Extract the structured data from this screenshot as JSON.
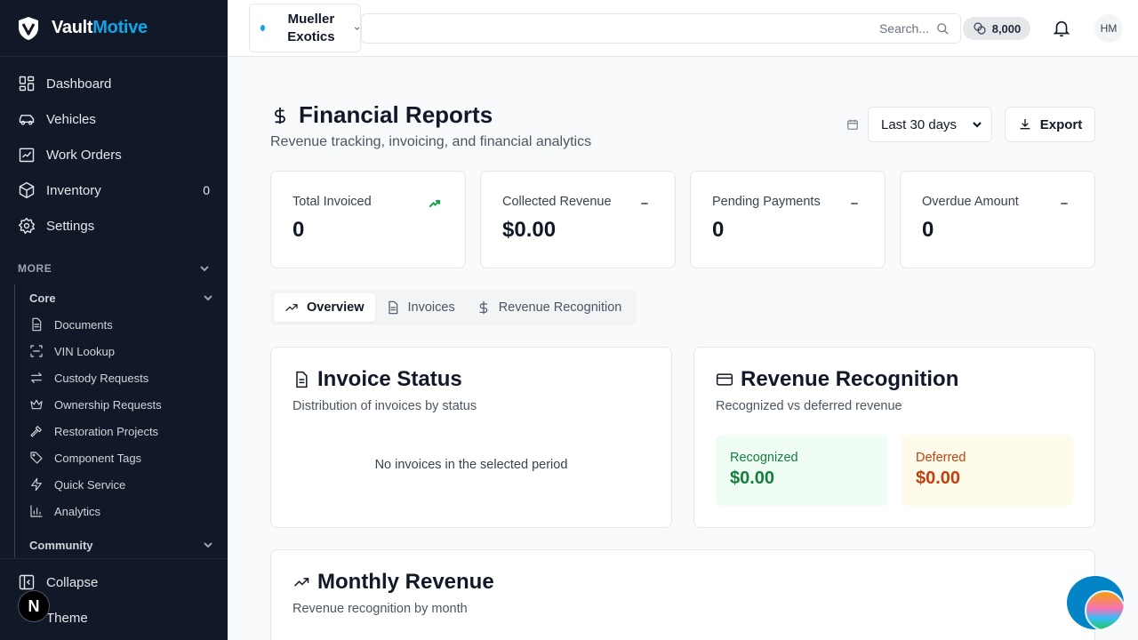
{
  "brand": {
    "name_part1": "Vault",
    "name_part2": "Motive"
  },
  "sidebar": {
    "nav": [
      {
        "label": "Dashboard",
        "icon": "dashboard-icon"
      },
      {
        "label": "Vehicles",
        "icon": "car-icon"
      },
      {
        "label": "Work Orders",
        "icon": "clipboard-icon"
      },
      {
        "label": "Inventory",
        "icon": "package-icon",
        "count": "0"
      },
      {
        "label": "Settings",
        "icon": "gear-icon"
      }
    ],
    "more_label": "MORE",
    "core_label": "Core",
    "core_items": [
      {
        "label": "Documents",
        "icon": "file-icon"
      },
      {
        "label": "VIN Lookup",
        "icon": "scan-icon"
      },
      {
        "label": "Custody Requests",
        "icon": "transfer-icon"
      },
      {
        "label": "Ownership Requests",
        "icon": "crown-icon"
      },
      {
        "label": "Restoration Projects",
        "icon": "hammer-icon"
      },
      {
        "label": "Component Tags",
        "icon": "tag-icon"
      },
      {
        "label": "Quick Service",
        "icon": "lightning-icon"
      },
      {
        "label": "Analytics",
        "icon": "bar-chart-icon"
      }
    ],
    "community_label": "Community",
    "collapse_label": "Collapse",
    "theme_label": "Theme",
    "next_badge": "N"
  },
  "topbar": {
    "org_name": "Mueller Exotics",
    "search_placeholder": "Search...",
    "credits": "8,000",
    "avatar_initials": "HM"
  },
  "page": {
    "title": "Financial Reports",
    "subtitle": "Revenue tracking, invoicing, and financial analytics",
    "date_range": "Last 30 days",
    "export_label": "Export"
  },
  "stats": [
    {
      "label": "Total Invoiced",
      "value": "0",
      "trend": "up",
      "color": "#16a34a"
    },
    {
      "label": "Collected Revenue",
      "value": "$0.00",
      "trend": "flat",
      "color": "#6b7280"
    },
    {
      "label": "Pending Payments",
      "value": "0",
      "trend": "flat",
      "color": "#6b7280"
    },
    {
      "label": "Overdue Amount",
      "value": "0",
      "trend": "flat",
      "color": "#6b7280"
    }
  ],
  "tabs": [
    {
      "label": "Overview",
      "icon": "trend-icon",
      "active": true
    },
    {
      "label": "Invoices",
      "icon": "file-icon",
      "active": false
    },
    {
      "label": "Revenue Recognition",
      "icon": "dollar-icon",
      "active": false
    }
  ],
  "invoice_status": {
    "title": "Invoice Status",
    "subtitle": "Distribution of invoices by status",
    "empty": "No invoices in the selected period"
  },
  "revenue_recognition": {
    "title": "Revenue Recognition",
    "subtitle": "Recognized vs deferred revenue",
    "recognized_label": "Recognized",
    "recognized_value": "$0.00",
    "deferred_label": "Deferred",
    "deferred_value": "$0.00"
  },
  "monthly_revenue": {
    "title": "Monthly Revenue",
    "subtitle": "Revenue recognition by month"
  },
  "colors": {
    "accent": "#0ea5e9",
    "sidebar_bg": "#111827",
    "recognized": "#15803d",
    "deferred": "#c2410c"
  }
}
